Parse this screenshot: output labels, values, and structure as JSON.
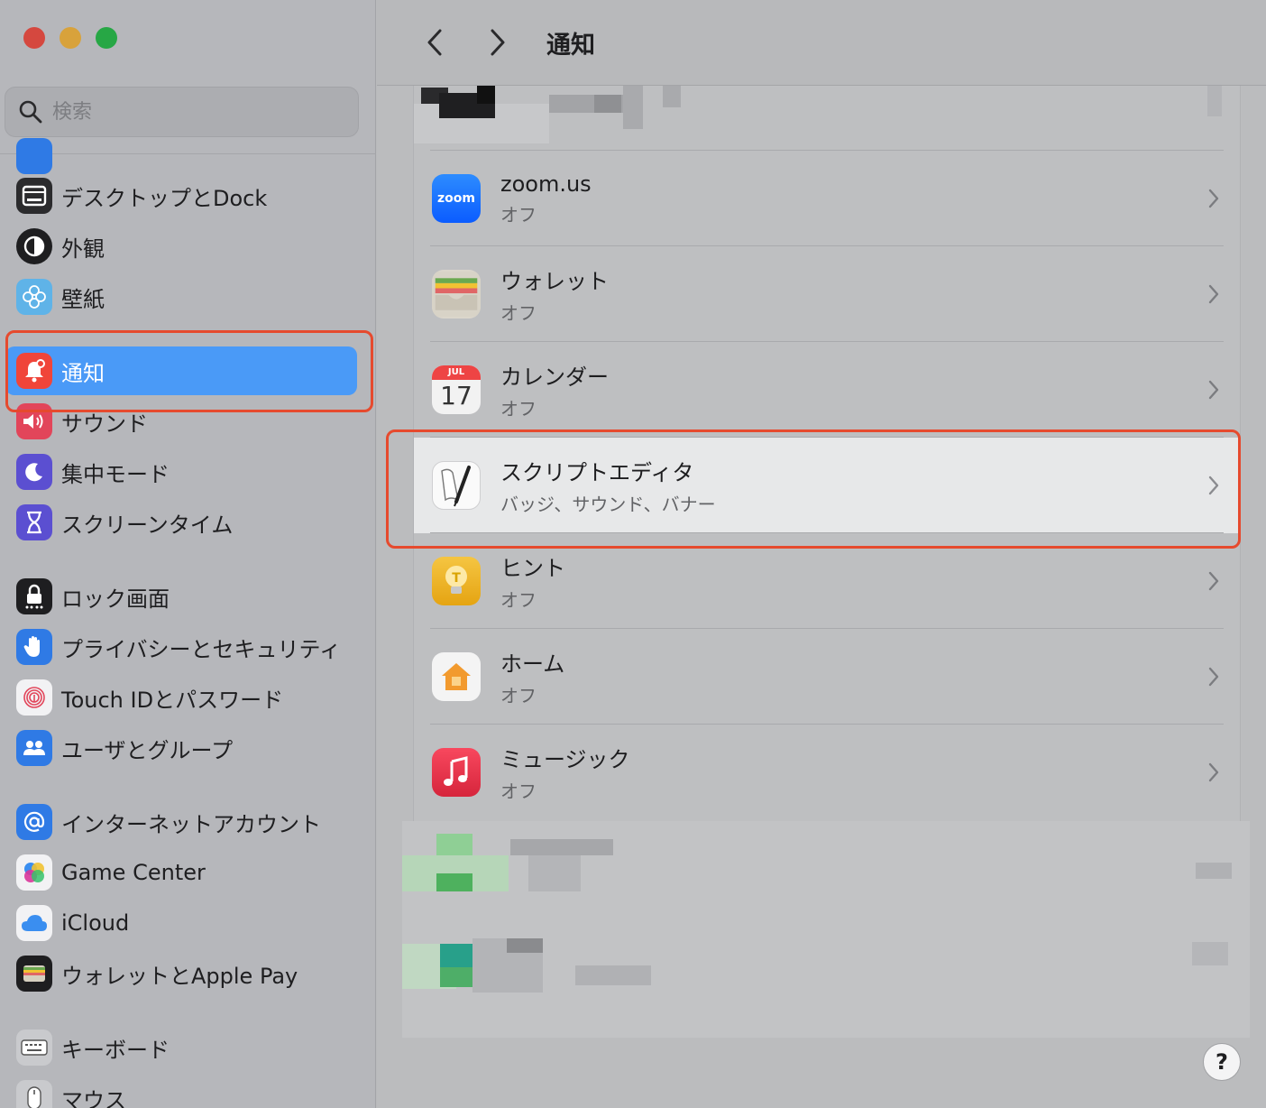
{
  "window": {
    "title": "通知"
  },
  "search": {
    "placeholder": "検索"
  },
  "sidebar": {
    "items": [
      {
        "label": "デスクトップとDock",
        "icon": "dock-icon",
        "color": "#2b2b2d"
      },
      {
        "label": "外観",
        "icon": "appearance-icon",
        "color": "#1e1e20"
      },
      {
        "label": "壁紙",
        "icon": "wallpaper-icon",
        "color": "#46a7e2"
      },
      {
        "label": "通知",
        "icon": "notification-bell-icon",
        "color": "#f0453a",
        "active": true
      },
      {
        "label": "サウンド",
        "icon": "speaker-icon",
        "color": "#e2455a"
      },
      {
        "label": "集中モード",
        "icon": "moon-icon",
        "color": "#5b4fd1"
      },
      {
        "label": "スクリーンタイム",
        "icon": "hourglass-icon",
        "color": "#5b4fd1"
      },
      {
        "label": "ロック画面",
        "icon": "lock-icon",
        "color": "#1e1e20"
      },
      {
        "label": "プライバシーとセキュリティ",
        "icon": "hand-icon",
        "color": "#2f7ae5"
      },
      {
        "label": "Touch IDとパスワード",
        "icon": "fingerprint-icon",
        "color": "#f2f2f4"
      },
      {
        "label": "ユーザとグループ",
        "icon": "users-icon",
        "color": "#2f7ae5"
      },
      {
        "label": "インターネットアカウント",
        "icon": "at-icon",
        "color": "#2f7ae5"
      },
      {
        "label": "Game Center",
        "icon": "game-center-icon",
        "color": "#f2f2f4"
      },
      {
        "label": "iCloud",
        "icon": "icloud-icon",
        "color": "#f2f2f4"
      },
      {
        "label": "ウォレットとApple Pay",
        "icon": "wallet-icon",
        "color": "#1e1e20"
      },
      {
        "label": "キーボード",
        "icon": "keyboard-icon",
        "color": "#c9cacd"
      },
      {
        "label": "マウス",
        "icon": "mouse-icon",
        "color": "#c9cacd"
      }
    ]
  },
  "apps": [
    {
      "name": "zoom.us",
      "status": "オフ",
      "icon": "zoom-icon",
      "icon_text": "zoom"
    },
    {
      "name": "ウォレット",
      "status": "オフ",
      "icon": "wallet-app-icon"
    },
    {
      "name": "カレンダー",
      "status": "オフ",
      "icon": "calendar-icon",
      "month": "JUL",
      "day": "17"
    },
    {
      "name": "スクリプトエディタ",
      "status": "バッジ、サウンド、バナー",
      "icon": "script-editor-icon",
      "highlighted": true
    },
    {
      "name": "ヒント",
      "status": "オフ",
      "icon": "tips-icon"
    },
    {
      "name": "ホーム",
      "status": "オフ",
      "icon": "home-icon"
    },
    {
      "name": "ミュージック",
      "status": "オフ",
      "icon": "music-icon"
    }
  ],
  "help": {
    "label": "?"
  }
}
